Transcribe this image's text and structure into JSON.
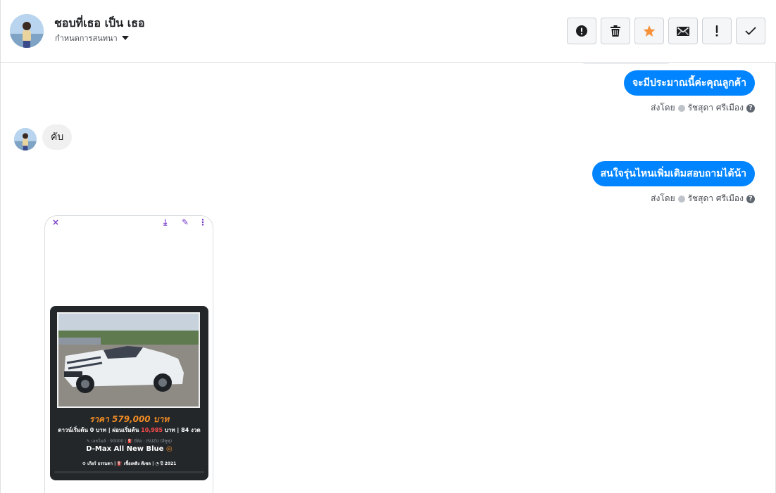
{
  "header": {
    "contact_name": "ชอบที่เธอ เป็น เธอ",
    "assign_label": "กำหนดการสนทนา",
    "actions": [
      {
        "name": "spam",
        "icon": "alert-circle-icon"
      },
      {
        "name": "delete",
        "icon": "trash-icon"
      },
      {
        "name": "star",
        "icon": "star-icon",
        "color": "#f7923b"
      },
      {
        "name": "mark-unread",
        "icon": "envelope-icon"
      },
      {
        "name": "follow-up",
        "icon": "exclamation-icon"
      },
      {
        "name": "done",
        "icon": "checkmark-icon"
      }
    ]
  },
  "messages": [
    {
      "direction": "outgoing",
      "text": "จะมีประมาณนี้ค่ะคุณลูกค้า",
      "sent_by_label": "ส่งโดย",
      "sender": "รัชสุดา ศรีเมือง"
    },
    {
      "direction": "incoming",
      "text": "คับ"
    },
    {
      "direction": "outgoing",
      "text": "สนใจรุ่นไหนเพิ่มเติมสอบถามได้น้า",
      "sent_by_label": "ส่งโดย",
      "sender": "รัชสุดา ศรีเมือง"
    }
  ],
  "attachment": {
    "tools": {
      "close": "×",
      "download": "⤓",
      "edit": "✎",
      "more": "⋮"
    },
    "price": "ราคา 579,000 บาท",
    "terms_a": "ดาวน์เริ่มต้น 0 บาท | ผ่อนเริ่มต้น ",
    "terms_highlight": "10,985",
    "terms_b": " บาท | 84 งวด",
    "tags": "✎ เลขไมล์ : 90000 | ⛽ ยี่ห้อ : ISUZU (อีซูซุ)",
    "model": "D-Max All New Blue",
    "specs": "⚙ เกียร์ ธรรมดา  |  ⛽ เชื้อเพลิง ดีเซล  |  ◔ ปี 2021"
  },
  "colors": {
    "outgoing_bubble": "#0084ff",
    "incoming_bubble": "#f0f0f0",
    "price_accent": "#f08a24",
    "highlight_red": "#ff4b4b"
  }
}
